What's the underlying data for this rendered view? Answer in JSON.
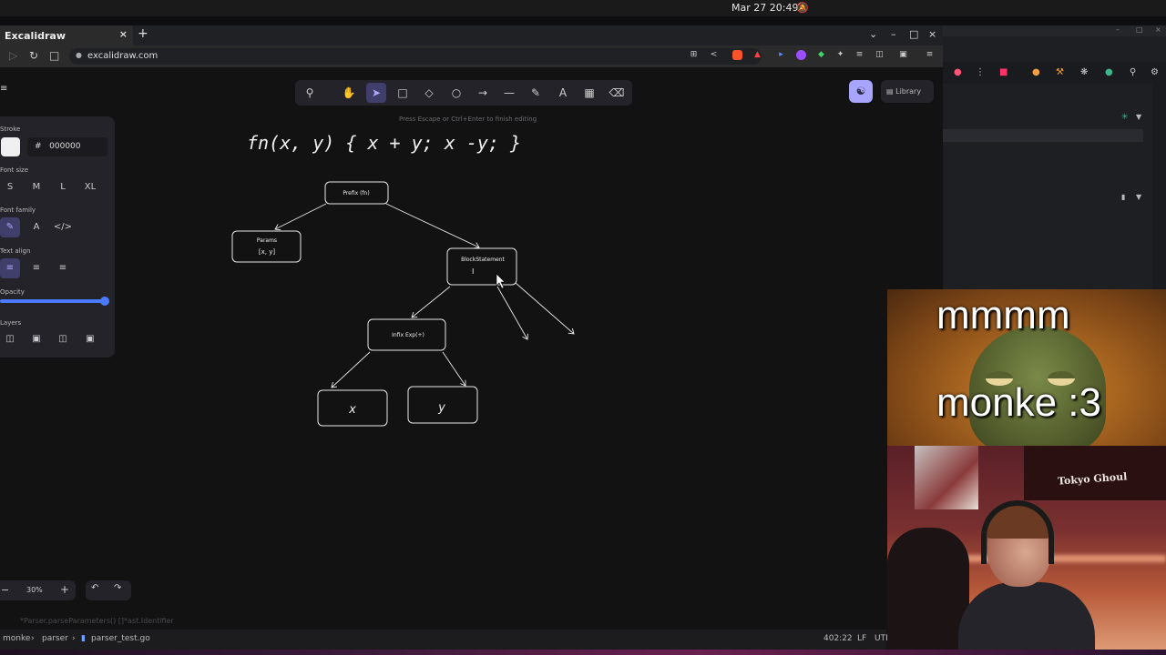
{
  "os": {
    "clock": "Mar 27  20:49",
    "bell_icon": "bell-icon"
  },
  "browser": {
    "tab_title": "Excalidraw",
    "tab_close": "×",
    "new_tab": "+",
    "url": "excalidraw.com",
    "window_controls": [
      "⌄",
      "–",
      "□",
      "×"
    ]
  },
  "excalidraw": {
    "hint": "Press Escape or Ctrl+Enter to finish editing",
    "library_label": "Library",
    "panel": {
      "stroke_label": "Stroke",
      "stroke_hex_prefix": "#",
      "stroke_hex": "000000",
      "font_size_label": "Font size",
      "font_sizes": [
        "S",
        "M",
        "L",
        "XL"
      ],
      "font_family_label": "Font family",
      "text_align_label": "Text align",
      "opacity_label": "Opacity",
      "opacity_value": 1.0,
      "layers_label": "Layers"
    },
    "zoom_value": "30%",
    "zoom_minus": "−",
    "zoom_plus": "+",
    "undo": "↶",
    "redo": "↷"
  },
  "drawing": {
    "heading": "fn(x, y) { x + y; x -y; }",
    "nodes": {
      "root": "Prefix (fn)",
      "params_line1": "Params",
      "params_line2": "[x, y]",
      "block": "BlockStatement",
      "block_cursor": "I",
      "infix": "Infix Exp(+)",
      "x": "x",
      "y": "y"
    }
  },
  "editor": {
    "hint": "*Parser.parseParameters() []*ast.Identifier",
    "breadcrumb": [
      "monke",
      "parser",
      "parser_test.go"
    ],
    "position": "402:22",
    "eol": "LF",
    "encoding": "UTF"
  },
  "overlay": {
    "meme_top": "mmmm",
    "meme_bottom": "monke :3",
    "poster_text": "Tokyo Ghoul"
  },
  "colors": {
    "accent": "#a8a5ff",
    "active_tool_bg": "#403e6a",
    "slider": "#4a7bff",
    "canvas_bg": "#121212"
  }
}
